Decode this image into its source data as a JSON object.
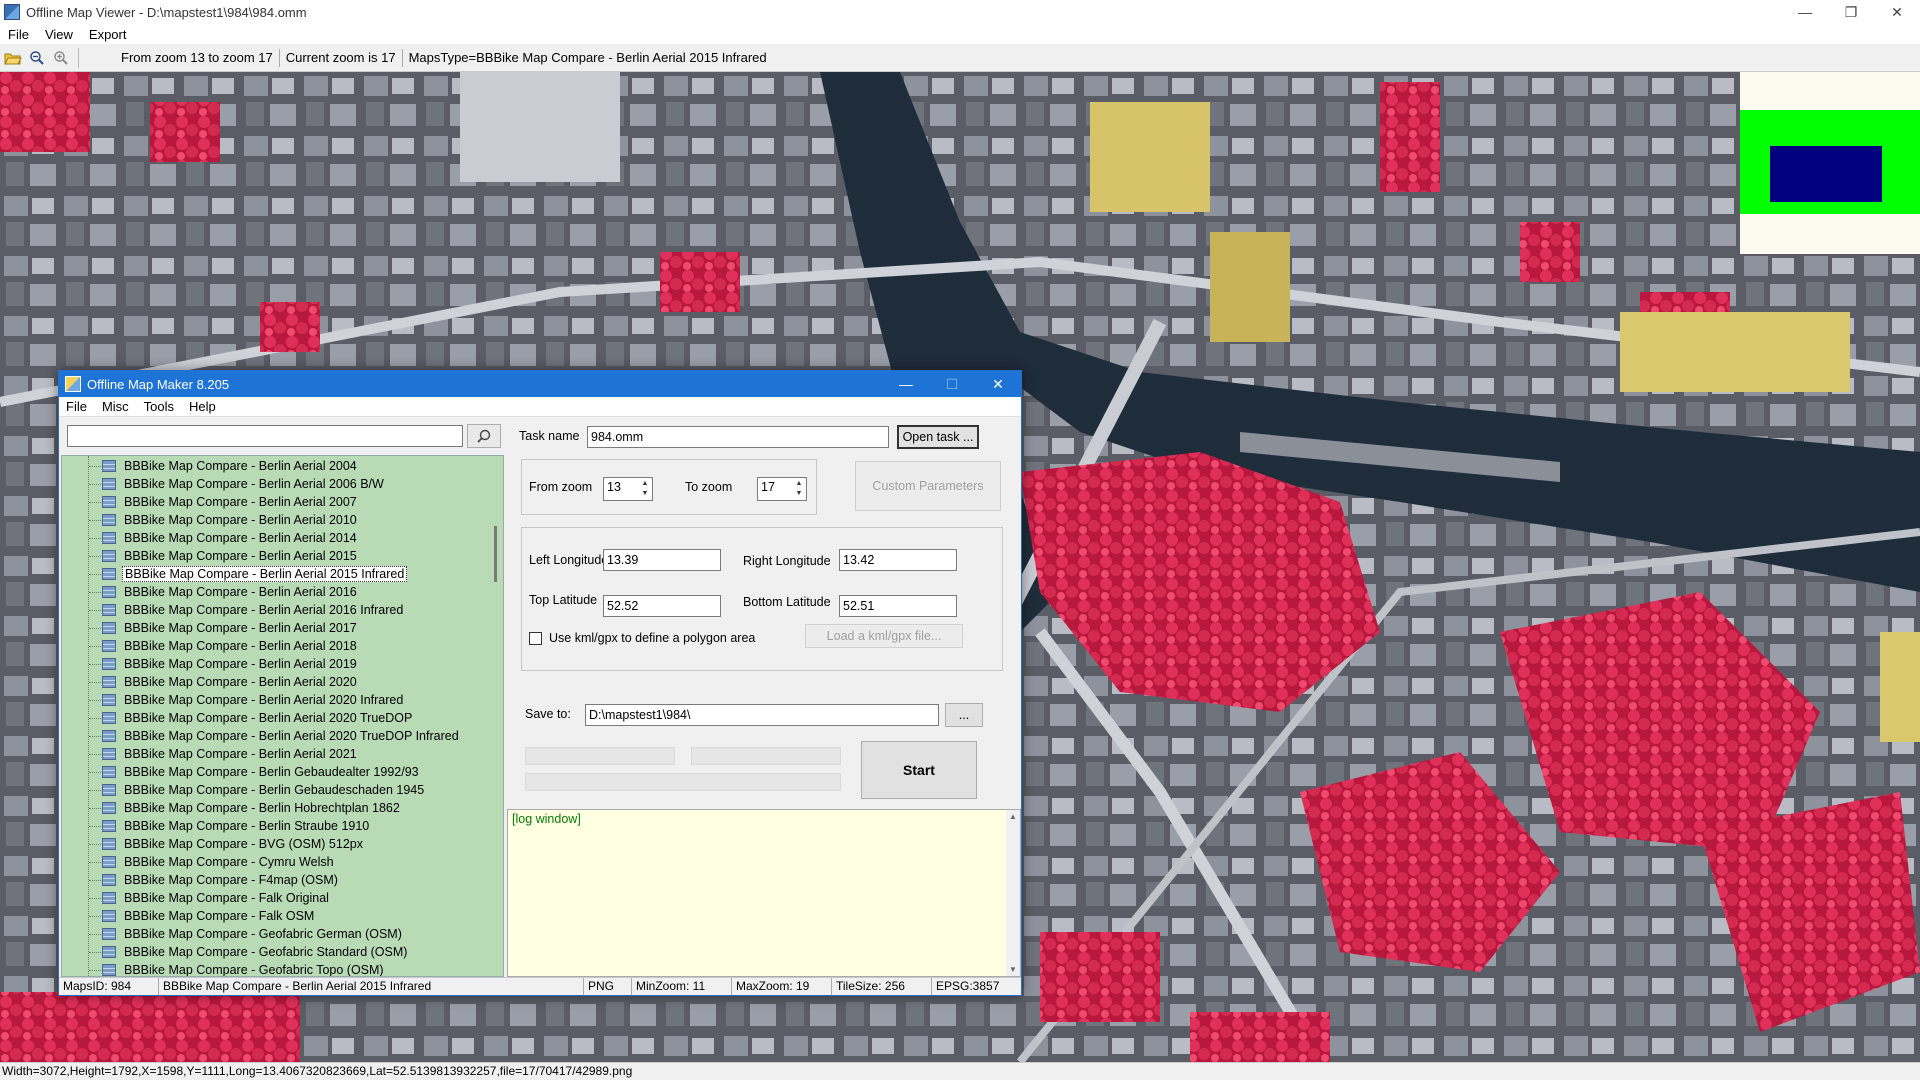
{
  "viewer": {
    "title": "Offline Map Viewer - D:\\mapstest1\\984\\984.omm",
    "window_controls": {
      "minimize": "—",
      "restore": "❐",
      "close": "✕"
    },
    "menu": [
      "File",
      "View",
      "Export"
    ],
    "toolbar": {
      "icons": [
        "open-folder-icon",
        "zoom-out-icon",
        "zoom-in-icon"
      ],
      "zoom_range": "From zoom 13 to zoom 17",
      "current_zoom": "Current zoom is 17",
      "maps_type": "MapsType=BBBike Map Compare - Berlin Aerial 2015 Infrared"
    },
    "statusbar": "Width=3072,Height=1792,X=1598,Y=1111,Long=13.4067320823669,Lat=52.5139813932257,file=17/70417/42989.png",
    "colors": {
      "overview_bg": "#fdfbef",
      "overview_frame": "#00ff00",
      "overview_view": "#000080",
      "vegetation": "#d8244a",
      "water": "#1f2c3a"
    }
  },
  "dialog": {
    "title": "Offline Map Maker 8.205",
    "window_controls": {
      "minimize": "—",
      "maximize": "☐",
      "close": "✕"
    },
    "menu": [
      "File",
      "Misc",
      "Tools",
      "Help"
    ],
    "search": {
      "value": "",
      "icon": "search-icon"
    },
    "map_list": [
      "BBBike Map Compare - Berlin Aerial 2004",
      "BBBike Map Compare - Berlin Aerial 2006 B/W",
      "BBBike Map Compare - Berlin Aerial 2007",
      "BBBike Map Compare - Berlin Aerial 2010",
      "BBBike Map Compare - Berlin Aerial 2014",
      "BBBike Map Compare - Berlin Aerial 2015",
      "BBBike Map Compare - Berlin Aerial 2015 Infrared",
      "BBBike Map Compare - Berlin Aerial 2016",
      "BBBike Map Compare - Berlin Aerial 2016 Infrared",
      "BBBike Map Compare - Berlin Aerial 2017",
      "BBBike Map Compare - Berlin Aerial 2018",
      "BBBike Map Compare - Berlin Aerial 2019",
      "BBBike Map Compare - Berlin Aerial 2020",
      "BBBike Map Compare - Berlin Aerial 2020 Infrared",
      "BBBike Map Compare - Berlin Aerial 2020 TrueDOP",
      "BBBike Map Compare - Berlin Aerial 2020 TrueDOP Infrared",
      "BBBike Map Compare - Berlin Aerial 2021",
      "BBBike Map Compare - Berlin Gebaudealter 1992/93",
      "BBBike Map Compare - Berlin Gebaudeschaden 1945",
      "BBBike Map Compare - Berlin Hobrechtplan 1862",
      "BBBike Map Compare - Berlin Straube 1910",
      "BBBike Map Compare - BVG (OSM) 512px",
      "BBBike Map Compare - Cymru Welsh",
      "BBBike Map Compare - F4map (OSM)",
      "BBBike Map Compare - Falk Original",
      "BBBike Map Compare - Falk OSM",
      "BBBike Map Compare - Geofabric German (OSM)",
      "BBBike Map Compare - Geofabric Standard (OSM)",
      "BBBike Map Compare - Geofabric Topo (OSM)"
    ],
    "selected_index": 6,
    "task": {
      "label": "Task name",
      "value": "984.omm",
      "open_button": "Open task ..."
    },
    "zoom": {
      "from_label": "From zoom",
      "from_value": "13",
      "to_label": "To zoom",
      "to_value": "17",
      "custom_button": "Custom Parameters"
    },
    "bounds": {
      "left_label": "Left Longitude",
      "left_value": "13.39",
      "right_label": "Right Longitude",
      "right_value": "13.42",
      "top_label": "Top Latitude",
      "top_value": "52.52",
      "bottom_label": "Bottom Latitude",
      "bottom_value": "52.51",
      "kml_checkbox_label": "Use kml/gpx to define a polygon area",
      "kml_checked": false,
      "kml_button": "Load a kml/gpx file..."
    },
    "save": {
      "label": "Save to:",
      "value": "D:\\mapstest1\\984\\",
      "browse_button": "..."
    },
    "start_button": "Start",
    "progress": [
      0,
      0,
      0
    ],
    "log": "[log window]",
    "status": {
      "maps_id": "MapsID: 984",
      "maps_name": "BBBike Map Compare - Berlin Aerial 2015 Infrared",
      "format": "PNG",
      "min_zoom": "MinZoom: 11",
      "max_zoom": "MaxZoom: 19",
      "tile_size": "TileSize: 256",
      "epsg": "EPSG:3857"
    }
  }
}
